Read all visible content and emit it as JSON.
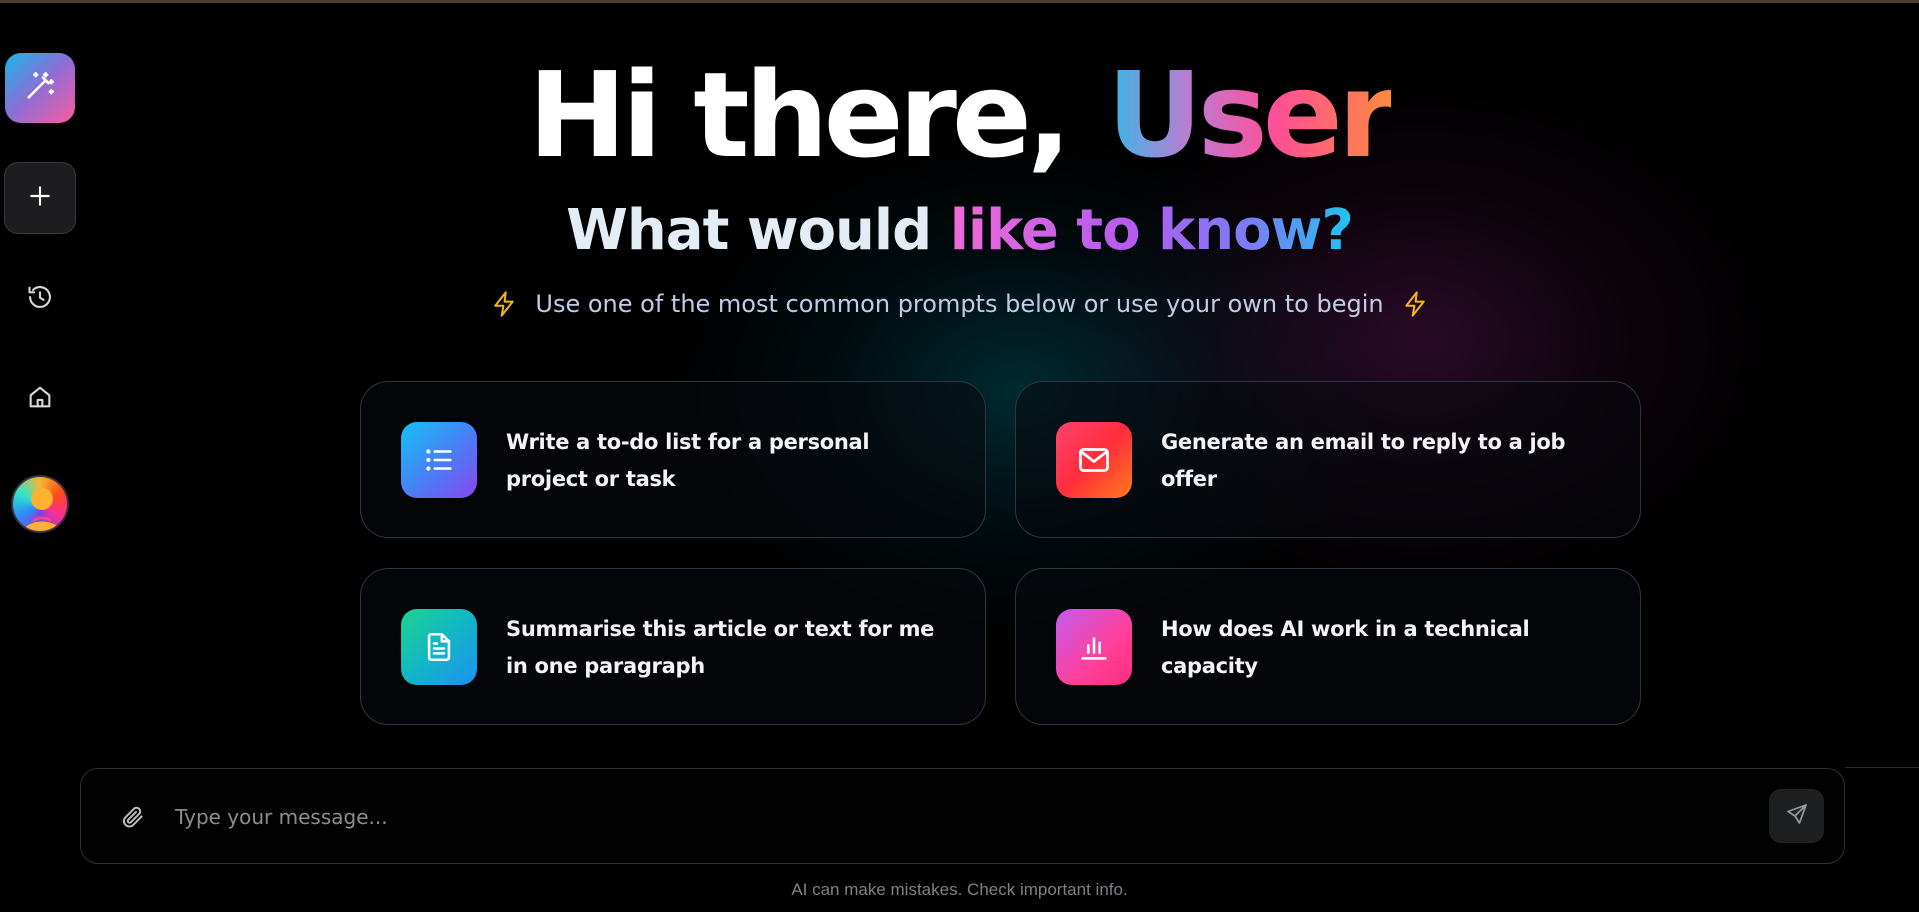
{
  "hero": {
    "greeting": "Hi there,",
    "user_name": "User",
    "question_plain": "What would",
    "question_accent": "like to know?",
    "hint": "Use one of the most common prompts below or use your own to begin"
  },
  "sidebar": {
    "items": [
      {
        "name": "logo",
        "icon": "magic-wand-icon"
      },
      {
        "name": "new-chat",
        "icon": "plus-icon"
      },
      {
        "name": "history",
        "icon": "history-icon"
      },
      {
        "name": "home",
        "icon": "home-icon"
      },
      {
        "name": "profile",
        "icon": "avatar"
      }
    ]
  },
  "prompts": [
    {
      "text": "Write a to-do list for a personal project or task",
      "icon": "list-icon"
    },
    {
      "text": "Generate an email to reply to a job offer",
      "icon": "mail-icon"
    },
    {
      "text": "Summarise this article or text for me in one paragraph",
      "icon": "document-icon"
    },
    {
      "text": "How does AI work in a technical capacity",
      "icon": "bar-chart-icon"
    }
  ],
  "composer": {
    "placeholder": "Type your message...",
    "value": ""
  },
  "footer": {
    "disclaimer": "AI can make mistakes. Check important info."
  },
  "colors": {
    "background": "#000000",
    "card_border": "#2e3740",
    "accent_yellow": "#f2b818"
  }
}
